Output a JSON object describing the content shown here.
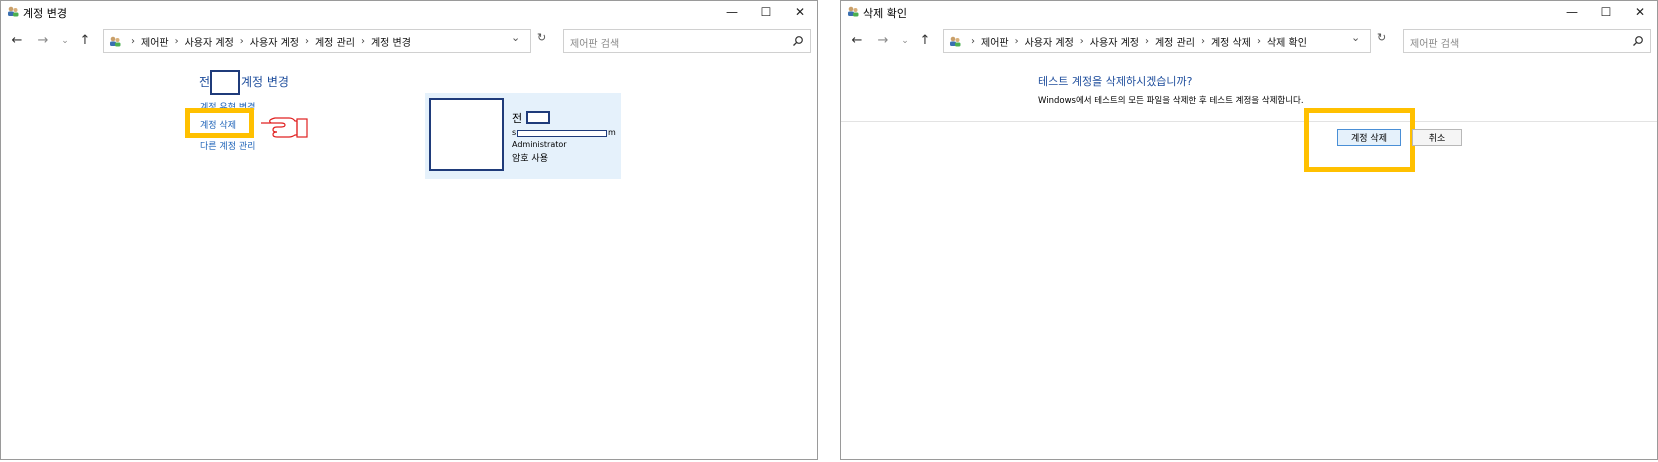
{
  "left_window": {
    "title": "계정 변경",
    "caption": {
      "minimize": "—",
      "maximize": "☐",
      "close": "✕"
    },
    "breadcrumb": [
      "제어판",
      "사용자 계정",
      "사용자 계정",
      "계정 관리",
      "계정 변경"
    ],
    "search_placeholder": "제어판 검색",
    "heading_prefix": "전",
    "heading_suffix": "계정 변경",
    "links": {
      "change_type": "계정 유형 변경",
      "delete": "계정 삭제",
      "manage_other": "다른 계정 관리"
    },
    "account_card": {
      "name_prefix": "전",
      "email_prefix": "s",
      "email_suffix": "m",
      "type": "Administrator",
      "password": "암호 사용"
    }
  },
  "right_window": {
    "title": "삭제 확인",
    "caption": {
      "minimize": "—",
      "maximize": "☐",
      "close": "✕"
    },
    "breadcrumb": [
      "제어판",
      "사용자 계정",
      "사용자 계정",
      "계정 관리",
      "계정 삭제",
      "삭제 확인"
    ],
    "search_placeholder": "제어판 검색",
    "question": "테스트 계정을 삭제하시겠습니까?",
    "description": "Windows에서 테스트의 모든 파일을 삭제한 후 테스트 계정을 삭제합니다.",
    "delete_button": "계정 삭제",
    "cancel_button": "취소"
  },
  "colors": {
    "highlight": "#ffc000",
    "link": "#1e63b8",
    "heading": "#1e4d9c",
    "redaction": "#1f3b7a",
    "card_bg": "#e5f1fb",
    "pointer": "#e02020"
  },
  "icons": [
    "user-accounts-icon",
    "back-arrow-icon",
    "forward-arrow-icon",
    "recent-dropdown-icon",
    "up-arrow-icon",
    "refresh-icon",
    "search-icon",
    "pointing-hand-icon"
  ]
}
